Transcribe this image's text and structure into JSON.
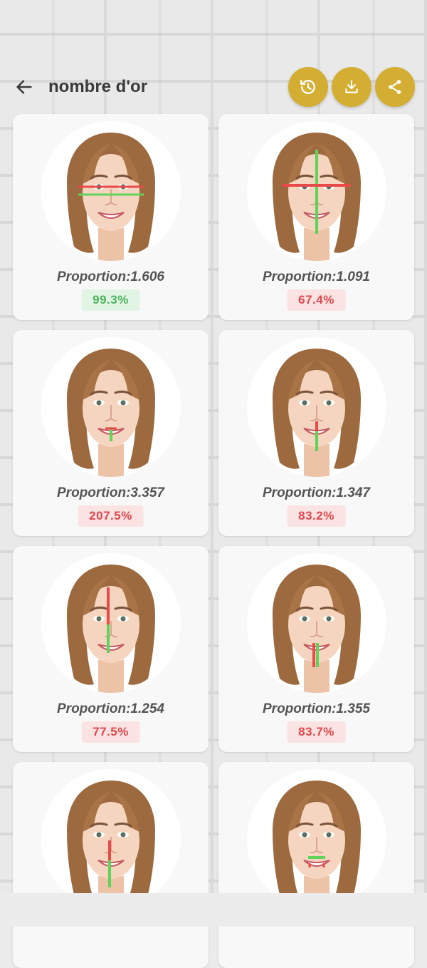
{
  "header": {
    "title": "nombre d'or",
    "back_icon": "arrow-left-icon",
    "actions": [
      {
        "name": "history-button",
        "icon": "history-icon"
      },
      {
        "name": "download-button",
        "icon": "download-icon"
      },
      {
        "name": "share-button",
        "icon": "share-icon"
      }
    ],
    "accent_color": "#d4ae32"
  },
  "cards": [
    {
      "proportion": "Proportion:1.606",
      "score": "99.3%",
      "status": "good"
    },
    {
      "proportion": "Proportion:1.091",
      "score": "67.4%",
      "status": "bad"
    },
    {
      "proportion": "Proportion:3.357",
      "score": "207.5%",
      "status": "bad"
    },
    {
      "proportion": "Proportion:1.347",
      "score": "83.2%",
      "status": "bad"
    },
    {
      "proportion": "Proportion:1.254",
      "score": "77.5%",
      "status": "bad"
    },
    {
      "proportion": "Proportion:1.355",
      "score": "83.7%",
      "status": "bad"
    },
    {
      "proportion": "",
      "score": "",
      "status": ""
    },
    {
      "proportion": "",
      "score": "",
      "status": ""
    }
  ],
  "colors": {
    "good": "#4bb35c",
    "bad": "#e0474c",
    "line_green": "#5fd35a",
    "line_red": "#e84a4a"
  }
}
